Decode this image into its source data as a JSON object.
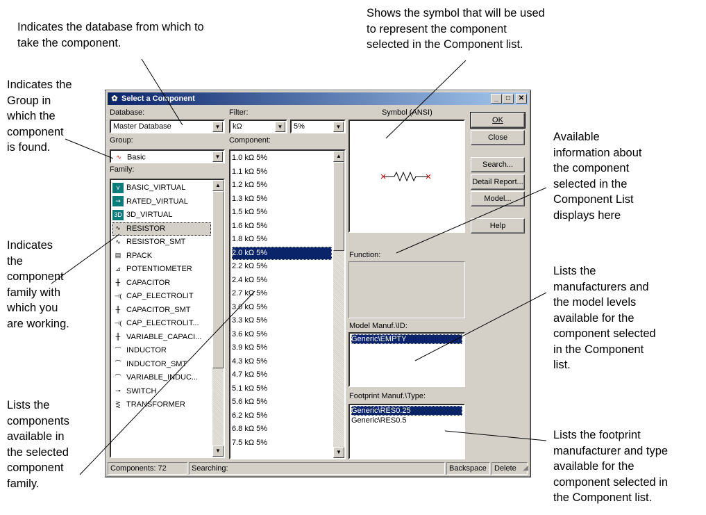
{
  "annotations": {
    "database": [
      "Indicates the database from which to",
      "take the component."
    ],
    "symbol": [
      "Shows the symbol that will be used",
      "to represent the component",
      "selected in the Component list."
    ],
    "group": [
      "Indicates the",
      "Group in",
      "which the",
      "component",
      "is found."
    ],
    "available_info": [
      "Available",
      "information about",
      "the component",
      "selected in the",
      "Component List",
      "displays here"
    ],
    "family": [
      "Indicates",
      "the",
      "component",
      "family with",
      "which you",
      "are working."
    ],
    "manufacturers": [
      "Lists the",
      "manufacturers and",
      "the model levels",
      "available for the",
      "component selected",
      "in the Component",
      "list."
    ],
    "components": [
      "Lists the",
      "components",
      "available in",
      "the selected",
      "component",
      "family."
    ],
    "footprint": [
      "Lists the footprint",
      "manufacturer and type",
      "available for the",
      "component selected in",
      "the Component list."
    ]
  },
  "dialog": {
    "title": "Select a Component",
    "database_label": "Database:",
    "database_value": "Master Database",
    "group_label": "Group:",
    "group_value": "Basic",
    "family_label": "Family:",
    "filter_label": "Filter:",
    "filter_value": "kΩ",
    "tolerance_value": "5%",
    "component_label": "Component:",
    "symbol_label": "Symbol (ANSI)",
    "function_label": "Function:",
    "model_label": "Model Manuf.\\ID:",
    "footprint_label": "Footprint Manuf.\\Type:"
  },
  "family_list": [
    {
      "label": "BASIC_VIRTUAL",
      "icon": "basic-virtual-icon",
      "selected": false
    },
    {
      "label": "RATED_VIRTUAL",
      "icon": "rated-virtual-icon",
      "selected": false
    },
    {
      "label": "3D_VIRTUAL",
      "icon": "3d-virtual-icon",
      "selected": false
    },
    {
      "label": "RESISTOR",
      "icon": "resistor-icon",
      "selected": true
    },
    {
      "label": "RESISTOR_SMT",
      "icon": "resistor-smt-icon",
      "selected": false
    },
    {
      "label": "RPACK",
      "icon": "rpack-icon",
      "selected": false
    },
    {
      "label": "POTENTIOMETER",
      "icon": "potentiometer-icon",
      "selected": false
    },
    {
      "label": "CAPACITOR",
      "icon": "capacitor-icon",
      "selected": false
    },
    {
      "label": "CAP_ELECTROLIT",
      "icon": "cap-electrolit-icon",
      "selected": false
    },
    {
      "label": "CAPACITOR_SMT",
      "icon": "capacitor-smt-icon",
      "selected": false
    },
    {
      "label": "CAP_ELECTROLIT...",
      "icon": "cap-electrolit-smt-icon",
      "selected": false
    },
    {
      "label": "VARIABLE_CAPACI...",
      "icon": "variable-capacitor-icon",
      "selected": false
    },
    {
      "label": "INDUCTOR",
      "icon": "inductor-icon",
      "selected": false
    },
    {
      "label": "INDUCTOR_SMT",
      "icon": "inductor-smt-icon",
      "selected": false
    },
    {
      "label": "VARIABLE_INDUC...",
      "icon": "variable-inductor-icon",
      "selected": false
    },
    {
      "label": "SWITCH",
      "icon": "switch-icon",
      "selected": false
    },
    {
      "label": "TRANSFORMER",
      "icon": "transformer-icon",
      "selected": false
    }
  ],
  "component_list": [
    "1.0 kΩ 5%",
    "1.1 kΩ 5%",
    "1.2 kΩ 5%",
    "1.3 kΩ 5%",
    "1.5 kΩ 5%",
    "1.6 kΩ 5%",
    "1.8 kΩ 5%",
    "2.0 kΩ 5%",
    "2.2 kΩ 5%",
    "2.4 kΩ 5%",
    "2.7 kΩ 5%",
    "3.0 kΩ 5%",
    "3.3 kΩ 5%",
    "3.6 kΩ 5%",
    "3.9 kΩ 5%",
    "4.3 kΩ 5%",
    "4.7 kΩ 5%",
    "5.1 kΩ 5%",
    "5.6 kΩ 5%",
    "6.2 kΩ 5%",
    "6.8 kΩ 5%",
    "7.5 kΩ 5%"
  ],
  "component_selected_index": 7,
  "model_list": [
    {
      "label": "Generic\\EMPTY",
      "selected": true
    }
  ],
  "footprint_list": [
    {
      "label": "Generic\\RES0.25",
      "selected": true
    },
    {
      "label": "Generic\\RES0.5",
      "selected": false
    }
  ],
  "buttons": {
    "ok": "OK",
    "close": "Close",
    "search": "Search...",
    "detail_report": "Detail Report...",
    "model": "Model...",
    "help": "Help"
  },
  "status": {
    "components": "Components: 72",
    "searching": "Searching:",
    "backspace": "Backspace",
    "delete": "Delete"
  },
  "colors": {
    "selection": "#0a246a",
    "titlebar": "#0a246a",
    "dialog": "#d4d0c8",
    "symbol_wire": "#cc0000"
  }
}
